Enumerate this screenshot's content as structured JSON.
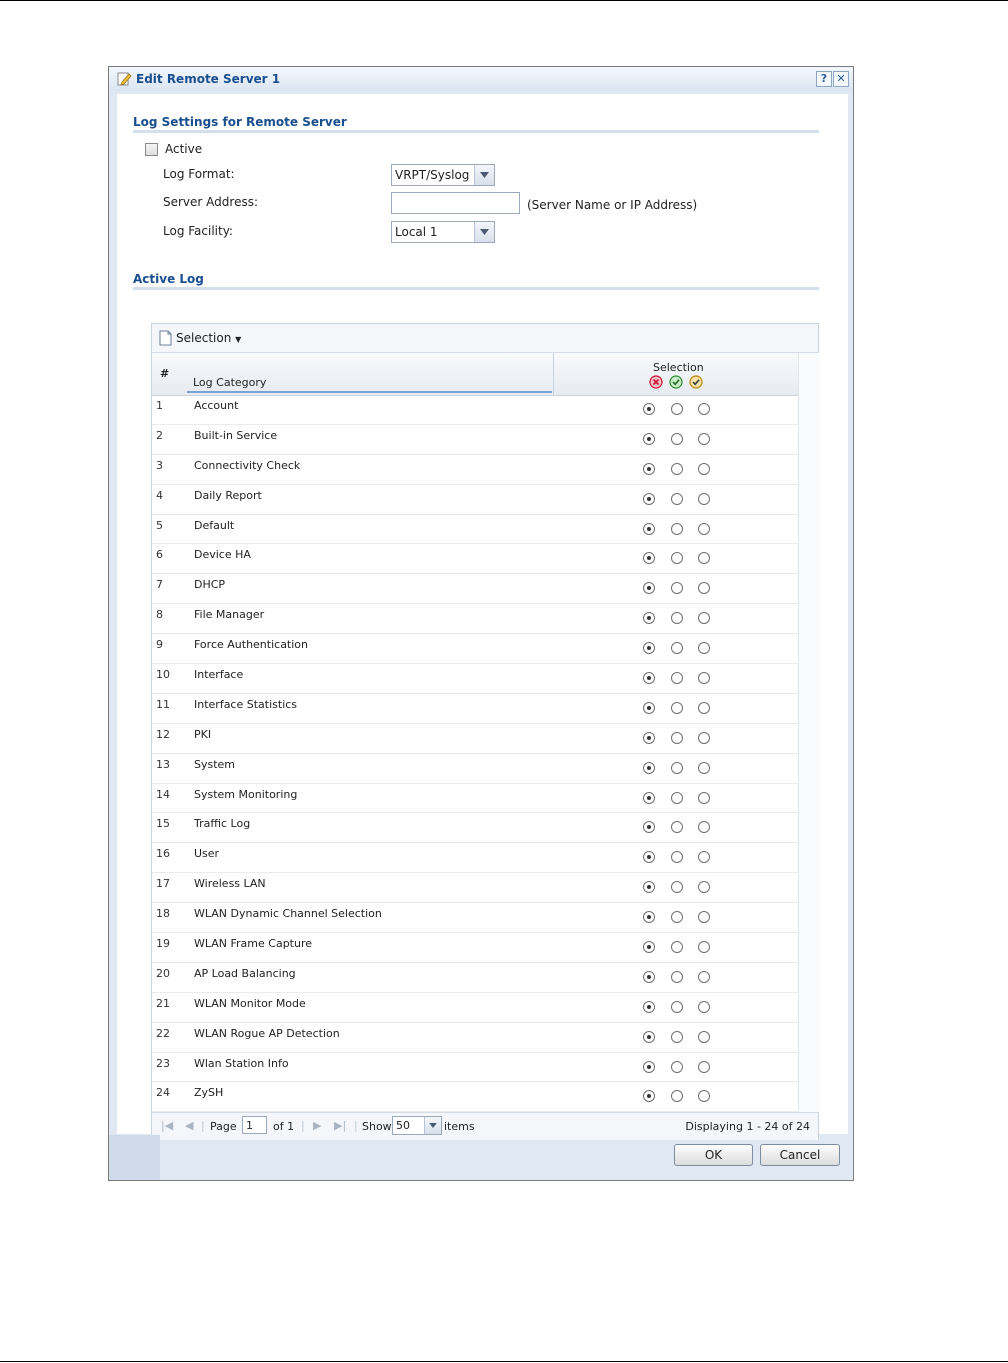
{
  "dialog": {
    "title": "Edit Remote Server 1",
    "help_label": "?",
    "close_label": "✕"
  },
  "log_settings": {
    "section_title": "Log Settings for Remote Server",
    "active_label": "Active",
    "active_checked": false,
    "log_format_label": "Log Format:",
    "log_format_value": "VRPT/Syslog",
    "server_address_label": "Server Address:",
    "server_address_value": "",
    "server_address_hint": "(Server Name or IP Address)",
    "log_facility_label": "Log Facility:",
    "log_facility_value": "Local 1"
  },
  "active_log": {
    "section_title": "Active Log",
    "toolbar_selection_label": "Selection",
    "col_num": "#",
    "col_category": "Log Category",
    "col_selection": "Selection",
    "rows": [
      {
        "num": "1",
        "category": "Account",
        "selected": 0
      },
      {
        "num": "2",
        "category": "Built-in Service",
        "selected": 0
      },
      {
        "num": "3",
        "category": "Connectivity Check",
        "selected": 0
      },
      {
        "num": "4",
        "category": "Daily Report",
        "selected": 0
      },
      {
        "num": "5",
        "category": "Default",
        "selected": 0
      },
      {
        "num": "6",
        "category": "Device HA",
        "selected": 0
      },
      {
        "num": "7",
        "category": "DHCP",
        "selected": 0
      },
      {
        "num": "8",
        "category": "File Manager",
        "selected": 0
      },
      {
        "num": "9",
        "category": "Force Authentication",
        "selected": 0
      },
      {
        "num": "10",
        "category": "Interface",
        "selected": 0
      },
      {
        "num": "11",
        "category": "Interface Statistics",
        "selected": 0
      },
      {
        "num": "12",
        "category": "PKI",
        "selected": 0
      },
      {
        "num": "13",
        "category": "System",
        "selected": 0
      },
      {
        "num": "14",
        "category": "System Monitoring",
        "selected": 0
      },
      {
        "num": "15",
        "category": "Traffic Log",
        "selected": 0
      },
      {
        "num": "16",
        "category": "User",
        "selected": 0
      },
      {
        "num": "17",
        "category": "Wireless LAN",
        "selected": 0
      },
      {
        "num": "18",
        "category": "WLAN Dynamic Channel Selection",
        "selected": 0
      },
      {
        "num": "19",
        "category": "WLAN Frame Capture",
        "selected": 0
      },
      {
        "num": "20",
        "category": "AP Load Balancing",
        "selected": 0
      },
      {
        "num": "21",
        "category": "WLAN Monitor Mode",
        "selected": 0
      },
      {
        "num": "22",
        "category": "WLAN Rogue AP Detection",
        "selected": 0
      },
      {
        "num": "23",
        "category": "Wlan Station Info",
        "selected": 0
      },
      {
        "num": "24",
        "category": "ZySH",
        "selected": 0
      }
    ],
    "pager": {
      "page_label": "Page",
      "page_value": "1",
      "of_label": "of 1",
      "show_label": "Show",
      "show_value": "50",
      "items_label": "items",
      "displaying": "Displaying 1 - 24 of 24"
    }
  },
  "buttons": {
    "ok": "OK",
    "cancel": "Cancel"
  },
  "colors": {
    "title_blue": "#1a4f8f",
    "disable_icon": "#c8102e",
    "enable_icon": "#2e8b2e",
    "debug_icon": "#b7860b"
  }
}
